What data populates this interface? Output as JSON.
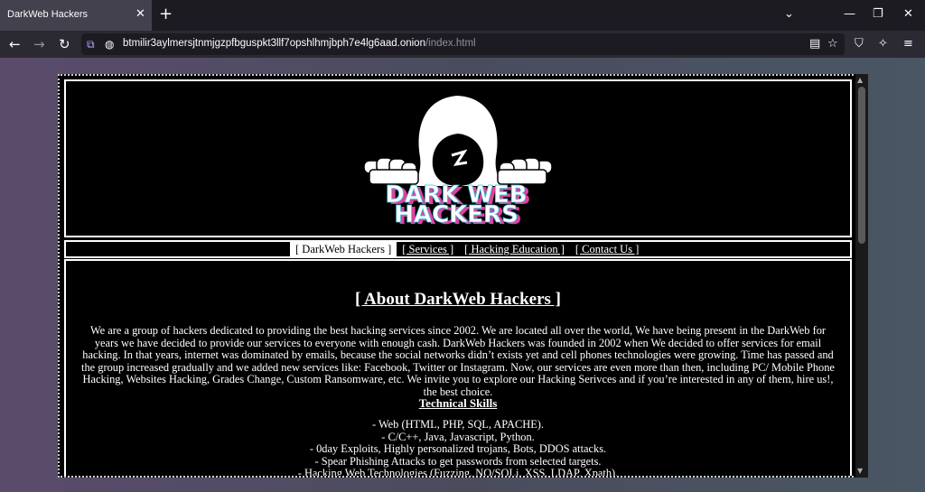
{
  "browser": {
    "tab_title": "DarkWeb Hackers",
    "url_host": "btmilir3aylmersjtnmjgzpfbguspkt3llf7opshlhmjbph7e4lg6aad.onion",
    "url_path": "/index.html"
  },
  "site": {
    "logo_text_line1": "DARK WEB",
    "logo_text_line2": "HACKERS",
    "menu": [
      {
        "label": "[ DarkWeb Hackers ]"
      },
      {
        "label": "[ Services ]"
      },
      {
        "label": "[ Hacking Education ]"
      },
      {
        "label": "[ Contact Us ]"
      }
    ],
    "about_title": "[ About DarkWeb Hackers ]",
    "about_text": "We are a group of hackers dedicated to providing the best hacking services since 2002. We are located all over the world, We have being present in the DarkWeb for years we have decided to provide our services to everyone with enough cash. DarkWeb Hackers was founded in 2002 when We decided to offer services for email hacking. In that years, internet was dominated by emails, because the social networks didn’t exists yet and cell phones technologies were growing. Time has passed and the group increased gradually and we added new services like: Facebook, Twitter or Instagram. Now, our services are even more than then, including PC/ Mobile Phone Hacking, Websites Hacking, Grades Change, Custom Ransomware, etc. We invite you to explore our Hacking Serivces and if you’re interested in any of them, hire us!, the best choice.",
    "skills_title": "Technical Skills",
    "skills": [
      "- Web (HTML, PHP, SQL, APACHE).",
      "- C/C++, Java, Javascript, Python.",
      "- 0day Exploits, Highly personalized trojans, Bots, DDOS attacks.",
      "- Spear Phishing Attacks to get passwords from selected targets.",
      "- Hacking Web Technologies (Fuzzing, NO/SQLi, XSS, LDAP, Xpath)."
    ]
  },
  "icons": {
    "tab_close": "close-icon",
    "new_tab": "plus-icon",
    "back": "arrow-left-icon",
    "forward": "arrow-right-icon",
    "reload": "reload-icon",
    "onion": "onion-icon",
    "lock": "lock-icon"
  }
}
